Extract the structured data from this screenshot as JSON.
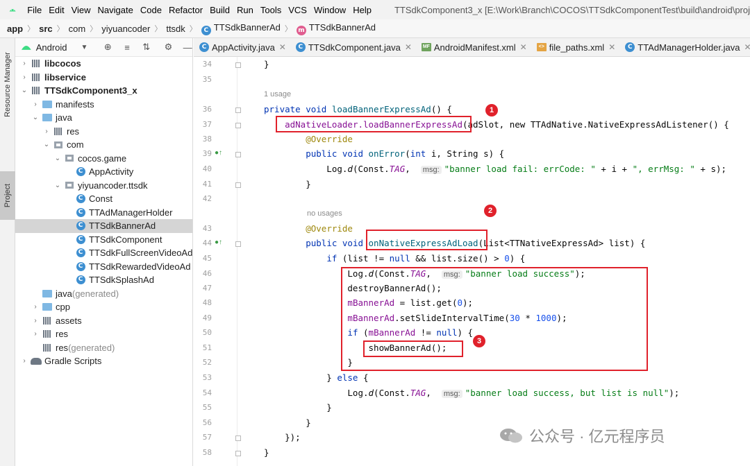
{
  "menubar": {
    "items": [
      "File",
      "Edit",
      "View",
      "Navigate",
      "Code",
      "Refactor",
      "Build",
      "Run",
      "Tools",
      "VCS",
      "Window",
      "Help"
    ],
    "window_title": "TTSdkComponent3_x [E:\\Work\\Branch\\COCOS\\TTSdkComponentTest\\build\\android\\proj"
  },
  "breadcrumb": {
    "items": [
      "app",
      "src",
      "com",
      "yiyuancoder",
      "ttsdk",
      "TTSdkBannerAd",
      "TTSdkBannerAd"
    ]
  },
  "toolstrip": {
    "resource_manager": "Resource Manager",
    "project": "Project"
  },
  "project_panel": {
    "view_label": "Android",
    "tree": [
      {
        "label": "libcocos",
        "bold": true
      },
      {
        "label": "libservice",
        "bold": true
      },
      {
        "label": "TTSdkComponent3_x",
        "bold": true
      },
      {
        "label": "manifests"
      },
      {
        "label": "java"
      },
      {
        "label": "res"
      },
      {
        "label": "com"
      },
      {
        "label": "cocos.game"
      },
      {
        "label": "AppActivity"
      },
      {
        "label": "yiyuancoder.ttsdk"
      },
      {
        "label": "Const"
      },
      {
        "label": "TTAdManagerHolder"
      },
      {
        "label": "TTSdkBannerAd",
        "selected": true
      },
      {
        "label": "TTSdkComponent"
      },
      {
        "label": "TTSdkFullScreenVideoAd"
      },
      {
        "label": "TTSdkRewardedVideoAd"
      },
      {
        "label": "TTSdkSplashAd"
      },
      {
        "label": "java",
        "suffix": " (generated)"
      },
      {
        "label": "cpp"
      },
      {
        "label": "assets"
      },
      {
        "label": "res"
      },
      {
        "label": "res",
        "suffix": " (generated)"
      },
      {
        "label": "Gradle Scripts"
      }
    ]
  },
  "tabs": [
    {
      "label": "AppActivity.java"
    },
    {
      "label": "TTSdkComponent.java"
    },
    {
      "label": "AndroidManifest.xml"
    },
    {
      "label": "file_paths.xml"
    },
    {
      "label": "TTAdManagerHolder.java"
    }
  ],
  "editor": {
    "line_numbers": [
      "34",
      "35",
      "36",
      "37",
      "38",
      "39",
      "40",
      "41",
      "42",
      "43",
      "44",
      "45",
      "46",
      "47",
      "48",
      "49",
      "50",
      "51",
      "52",
      "53",
      "54",
      "55",
      "56",
      "57",
      "58"
    ],
    "hints": {
      "usage_1": "1 usage",
      "no_usages": "no usages"
    },
    "param_hint": "msg:",
    "strings": {
      "error": "\"banner load fail: errCode: \"",
      "error_msg": "\", errMsg: \"",
      "success": "\"banner load success\"",
      "success_null": "\"banner load success, but list is null\""
    },
    "code": {
      "c34": "}",
      "load_method": "loadBannerExpressAd",
      "ad_loader_call": "adNativeLoader.loadBannerExpressAd",
      "listener_tail": "(adSlot, new TTAdNative.NativeExpressAdListener() {",
      "on_error_sig": "onError",
      "on_load_sig": "onNativeExpressAdLoad",
      "show_banner": "showBannerAd();"
    }
  },
  "annotations": {
    "badges": [
      "1",
      "2",
      "3"
    ]
  },
  "watermark": {
    "text": "公众号 · 亿元程序员"
  }
}
